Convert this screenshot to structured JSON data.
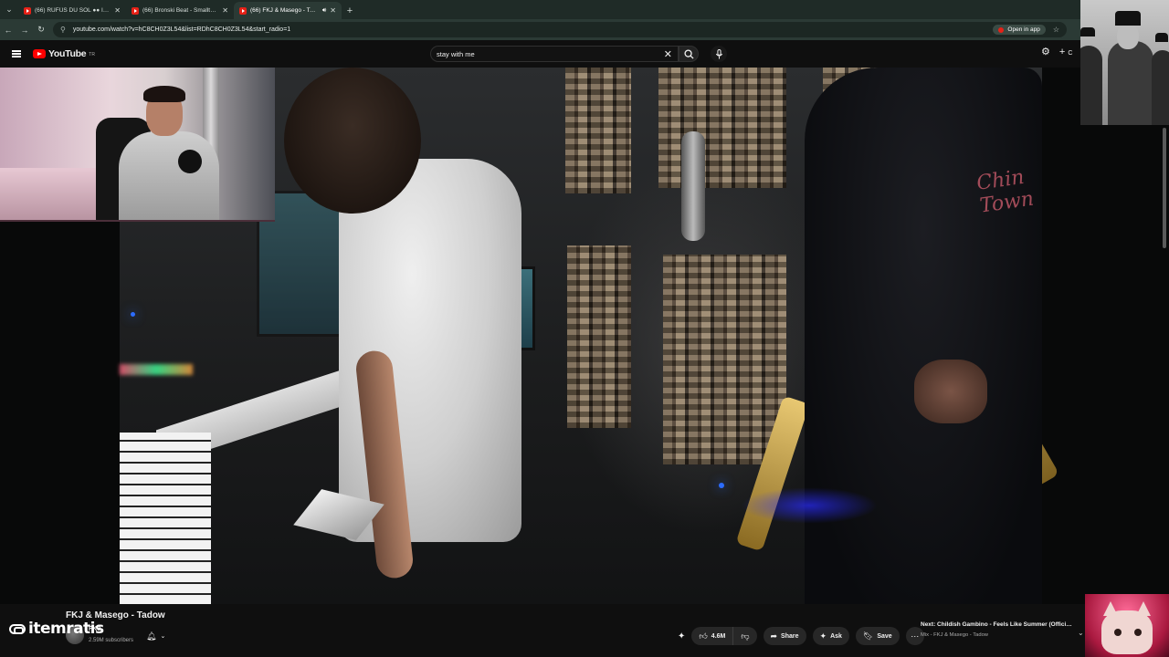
{
  "browser": {
    "tabs": [
      {
        "title": "(66) RÜFÜS DU SOL ●● Innerbloom",
        "active": false,
        "audio": false
      },
      {
        "title": "(66) Bronski Beat - Smalltown Boy",
        "active": false,
        "audio": false
      },
      {
        "title": "(66) FKJ & Masego - Tadow",
        "active": true,
        "audio": true
      }
    ],
    "url": "youtube.com/watch?v=hC8CH0Z3L54&list=RDhC8CH0Z3L54&start_radio=1",
    "open_in_app_label": "Open in app"
  },
  "youtube": {
    "logo_text": "YouTube",
    "region_code": "TR",
    "search_query": "stay with me",
    "header_partial_text": "C"
  },
  "video": {
    "title": "FKJ & Masego - Tadow",
    "channel_name": "FKJ",
    "subscribers": "2.59M subscribers",
    "like_count": "4.6M",
    "share_label": "Share",
    "ask_label": "Ask",
    "save_label": "Save"
  },
  "next_up": {
    "title": "Next: Childish Gambino - Feels Like Summer (Official Music Video)",
    "subtitle": "Mix - FKJ & Masego - Tadow"
  },
  "overlay": {
    "watermark": "itemratis",
    "scene_text": "Chin Town"
  },
  "colors": {
    "youtube_red": "#ff0000",
    "background": "#0f0f0f",
    "pill": "#272727",
    "browser_frame": "#2b3a35"
  }
}
